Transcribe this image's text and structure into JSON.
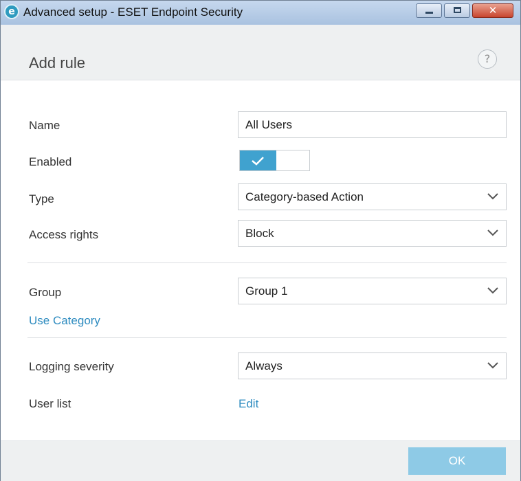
{
  "window": {
    "title": "Advanced setup - ESET Endpoint Security",
    "app_icon_letter": "e",
    "close_glyph": "✕"
  },
  "header": {
    "title": "Add rule",
    "help_glyph": "?"
  },
  "form": {
    "name": {
      "label": "Name",
      "value": "All Users"
    },
    "enabled": {
      "label": "Enabled",
      "state": true,
      "check_glyph": "✓"
    },
    "type": {
      "label": "Type",
      "value": "Category-based Action"
    },
    "access_rights": {
      "label": "Access rights",
      "value": "Block"
    },
    "group": {
      "label": "Group",
      "value": "Group 1"
    },
    "use_category_link": "Use Category",
    "logging_severity": {
      "label": "Logging severity",
      "value": "Always"
    },
    "user_list": {
      "label": "User list",
      "link": "Edit"
    }
  },
  "footer": {
    "ok_label": "OK"
  },
  "colors": {
    "accent": "#40a2cf",
    "link": "#2f8cc0",
    "ok_button": "#8ecae6"
  }
}
